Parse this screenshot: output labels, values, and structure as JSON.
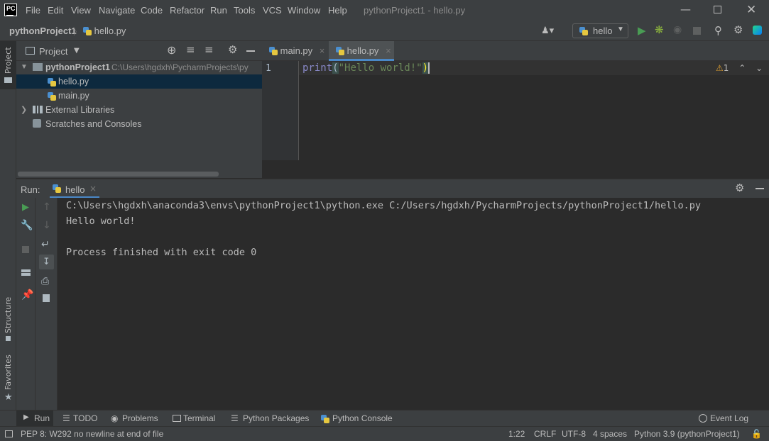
{
  "menu": {
    "items": [
      "File",
      "Edit",
      "View",
      "Navigate",
      "Code",
      "Refactor",
      "Run",
      "Tools",
      "VCS",
      "Window",
      "Help"
    ],
    "window_title": "pythonProject1 - hello.py"
  },
  "navbar": {
    "project": "pythonProject1",
    "file": "hello.py",
    "run_config": "hello"
  },
  "left_strip": {
    "project": "Project",
    "structure": "Structure",
    "favorites": "Favorites"
  },
  "project_panel": {
    "title": "Project",
    "root_name": "pythonProject1",
    "root_path": "C:\\Users\\hgdxh\\PycharmProjects\\py",
    "files": [
      "hello.py",
      "main.py"
    ],
    "external": "External Libraries",
    "scratches": "Scratches and Consoles"
  },
  "editor": {
    "tabs": [
      "main.py",
      "hello.py"
    ],
    "active_tab": "hello.py",
    "line_number": "1",
    "code_func": "print",
    "code_open": "(",
    "code_string": "\"Hello world!\"",
    "code_close": ")",
    "warning_count": "1"
  },
  "run_panel": {
    "label": "Run:",
    "tab": "hello",
    "lines": [
      "C:\\Users\\hgdxh\\anaconda3\\envs\\pythonProject1\\python.exe C:/Users/hgdxh/PycharmProjects/pythonProject1/hello.py",
      "Hello world!",
      "",
      "Process finished with exit code 0"
    ]
  },
  "bottom_tabs": [
    "Run",
    "TODO",
    "Problems",
    "Terminal",
    "Python Packages",
    "Python Console"
  ],
  "event_log": "Event Log",
  "status": {
    "message": "PEP 8: W292 no newline at end of file",
    "position": "1:22",
    "line_sep": "CRLF",
    "encoding": "UTF-8",
    "indent": "4 spaces",
    "interpreter": "Python 3.9 (pythonProject1)"
  },
  "colors": {
    "keyword": "#8888c6",
    "string": "#6a8759",
    "paren_match": "#ffef28",
    "run_green": "#499c54",
    "debug_green": "#8bb33d"
  }
}
